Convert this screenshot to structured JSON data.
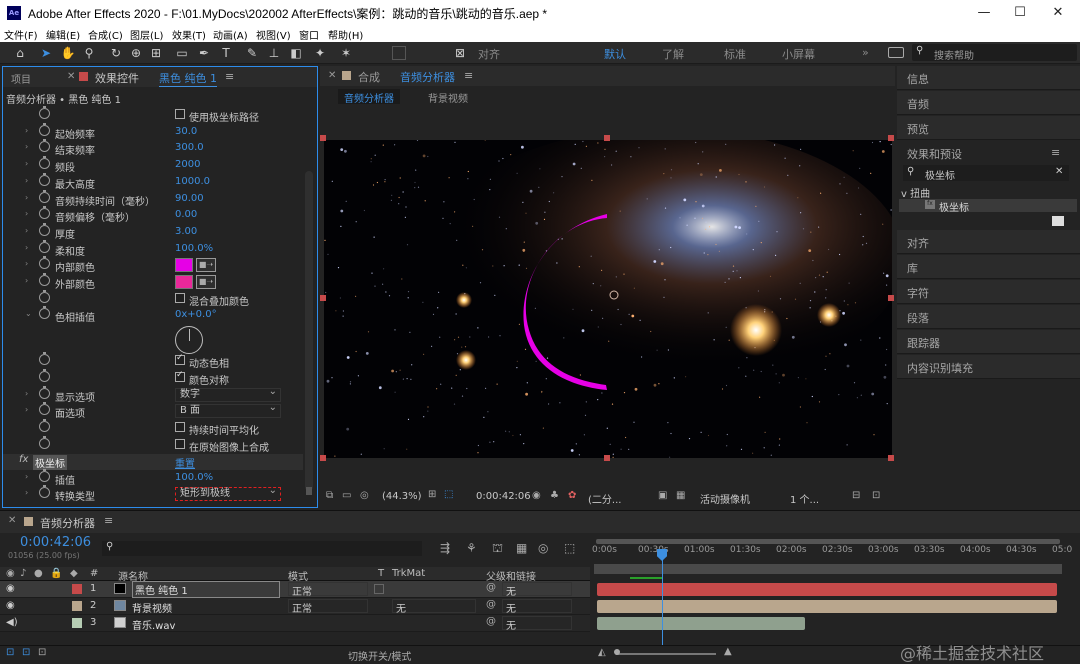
{
  "window": {
    "title": "Adobe After Effects 2020 - F:\\01.MyDocs\\202002 AfterEffects\\案例：跳动的音乐\\跳动的音乐.aep *",
    "logo": "Ae",
    "minimize": "—",
    "maximize": "☐",
    "close": "✕"
  },
  "menu": [
    "文件(F)",
    "编辑(E)",
    "合成(C)",
    "图层(L)",
    "效果(T)",
    "动画(A)",
    "视图(V)",
    "窗口",
    "帮助(H)"
  ],
  "toolbar": {
    "align_label": "对齐",
    "workspaces": [
      "默认",
      "了解",
      "标准",
      "小屏幕"
    ],
    "more": "»",
    "search_placeholder": "搜索帮助"
  },
  "left_panel": {
    "tab_project": "项目",
    "tab_effects_prefix": "效果控件",
    "tab_effects_layer": "黑色 纯色 1",
    "breadcrumb": "音频分析器 • 黑色 纯色 1",
    "rows": [
      {
        "type": "check",
        "label": "",
        "checklabel": "使用极坐标路径",
        "checked": false
      },
      {
        "type": "value",
        "label": "起始频率",
        "value": "30.0"
      },
      {
        "type": "value",
        "label": "结束频率",
        "value": "300.0"
      },
      {
        "type": "value",
        "label": "频段",
        "value": "2000"
      },
      {
        "type": "value",
        "label": "最大高度",
        "value": "1000.0"
      },
      {
        "type": "value",
        "label": "音频持续时间（毫秒）",
        "value": "90.00"
      },
      {
        "type": "value",
        "label": "音频偏移（毫秒）",
        "value": "0.00"
      },
      {
        "type": "value",
        "label": "厚度",
        "value": "3.00"
      },
      {
        "type": "value",
        "label": "柔和度",
        "value": "100.0%"
      },
      {
        "type": "color",
        "label": "内部颜色",
        "color": "#e600e6"
      },
      {
        "type": "color",
        "label": "外部颜色",
        "color": "#e9289a"
      },
      {
        "type": "check",
        "label": "",
        "checklabel": "混合叠加颜色",
        "checked": false
      },
      {
        "type": "hue",
        "label": "色相插值",
        "value": "0x+0.0°"
      },
      {
        "type": "check",
        "label": "",
        "checklabel": "动态色相",
        "checked": true
      },
      {
        "type": "check",
        "label": "",
        "checklabel": "颜色对称",
        "checked": true
      },
      {
        "type": "dropdown",
        "label": "显示选项",
        "value": "数字"
      },
      {
        "type": "dropdown",
        "label": "面选项",
        "value": "B 面"
      },
      {
        "type": "check",
        "label": "",
        "checklabel": "持续时间平均化",
        "checked": false
      },
      {
        "type": "check",
        "label": "",
        "checklabel": "在原始图像上合成",
        "checked": false
      }
    ],
    "fx_name": "极坐标",
    "fx_reset": "重置",
    "fx_rows": [
      {
        "type": "value",
        "label": "插值",
        "value": "100.0%"
      },
      {
        "type": "dropdown",
        "label": "转换类型",
        "value": "矩形到极线"
      }
    ]
  },
  "comp_panel": {
    "tab_label": "合成",
    "comp_name": "音频分析器",
    "subtabs": [
      "音频分析器",
      "背景视频"
    ],
    "zoom": "(44.3%)",
    "time": "0:00:42:06",
    "resolution": "(二分...",
    "camera": "活动摄像机",
    "views": "1 个..."
  },
  "right_panel": {
    "items": [
      "信息",
      "音频",
      "预览",
      "效果和预设",
      "对齐",
      "库",
      "字符",
      "段落",
      "跟踪器",
      "内容识别填充"
    ],
    "search_value": "极坐标",
    "tree_group": "扭曲",
    "tree_item": "极坐标"
  },
  "timeline": {
    "comp_tab": "音频分析器",
    "timecode": "0:00:42:06",
    "frame_info": "01056 (25.00 fps)",
    "search_placeholder": "",
    "headers": {
      "num": "#",
      "name": "源名称",
      "mode": "模式",
      "t": "T",
      "trkmat": "TrkMat",
      "parent": "父级和链接"
    },
    "layers": [
      {
        "num": "1",
        "name": "黑色 纯色 1",
        "mode": "正常",
        "trkmat": "",
        "parent": "无",
        "color": "#c64a4a",
        "icon_color": "#000000"
      },
      {
        "num": "2",
        "name": "背景视频",
        "mode": "正常",
        "trkmat": "无",
        "parent": "无",
        "color": "#b9a68d",
        "icon_color": "#6f87a0"
      },
      {
        "num": "3",
        "name": "音乐.wav",
        "mode": "",
        "trkmat": "",
        "parent": "无",
        "color": "#b6cdb4",
        "icon_color": "#d0d0d0"
      }
    ],
    "ruler": [
      "0:00s",
      "00:30s",
      "01:00s",
      "01:30s",
      "02:00s",
      "02:30s",
      "03:00s",
      "03:30s",
      "04:00s",
      "04:30s",
      "05:0"
    ],
    "footer": "切换开关/模式",
    "watermark": "@稀土掘金技术社区"
  },
  "colors": {
    "accent": "#2d8ceb",
    "value_blue": "#3d8fe0",
    "track_red": "#c64a4a",
    "track_tan": "#b9a68d",
    "track_sage": "#8fa08e",
    "spectrum_magenta": "#e600e6"
  }
}
